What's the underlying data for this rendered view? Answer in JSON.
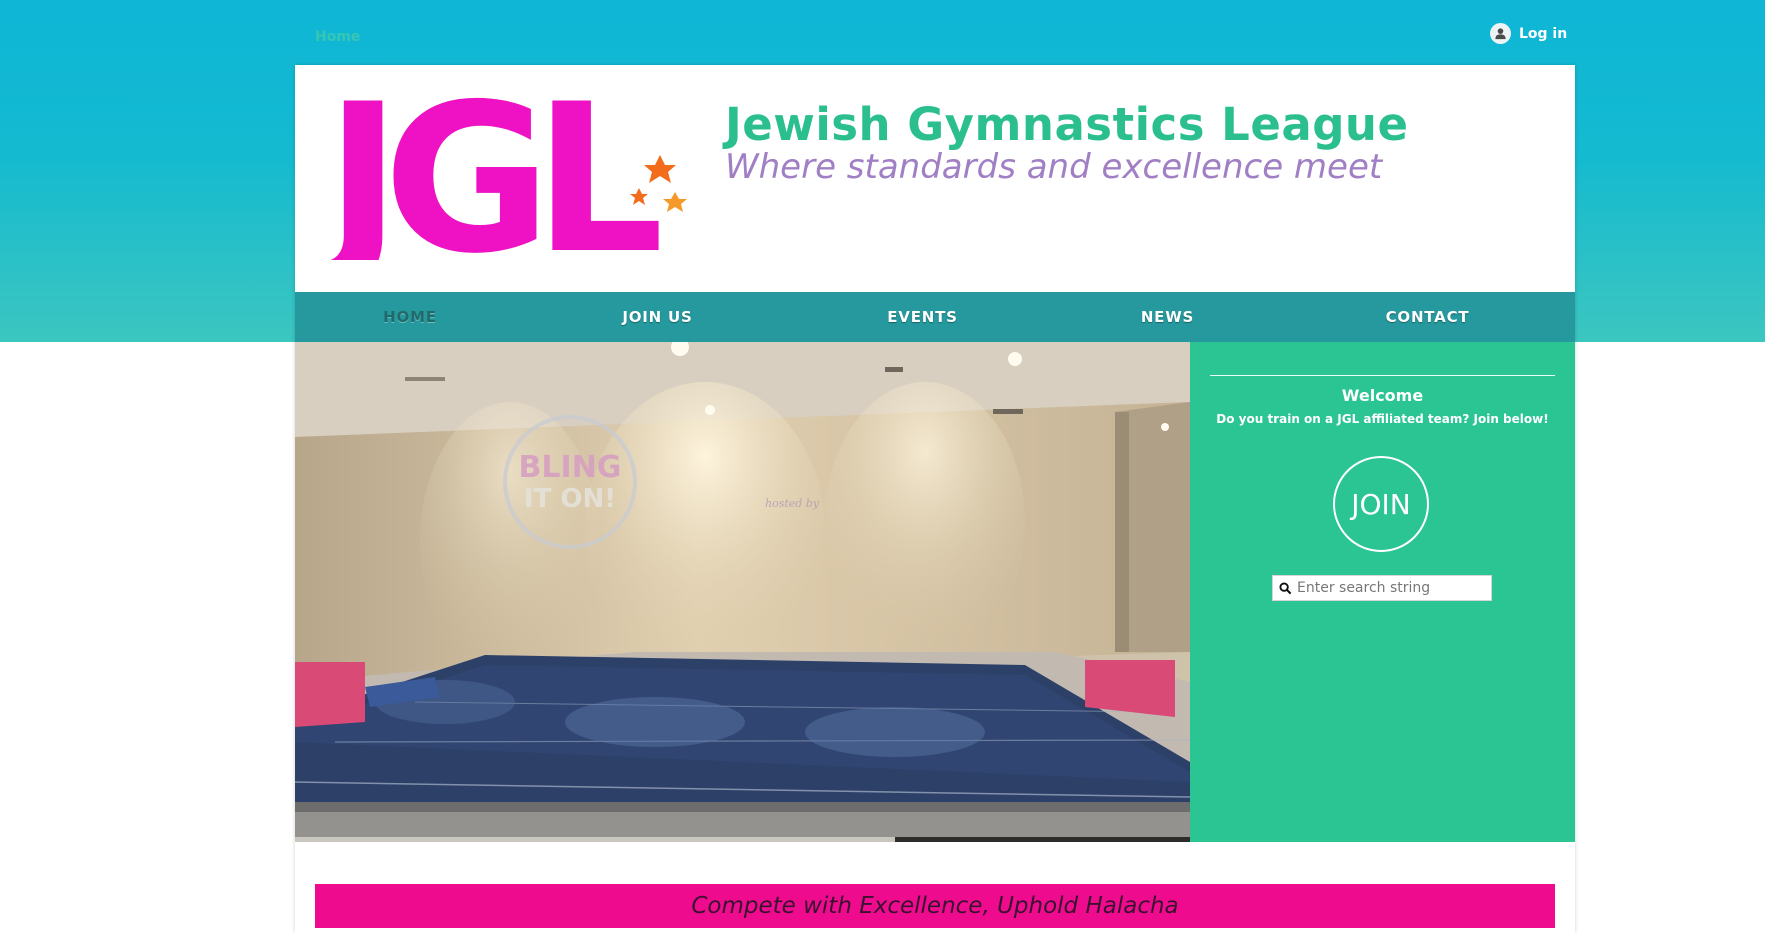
{
  "topbar": {
    "breadcrumb": "Home",
    "login_label": "Log in"
  },
  "header": {
    "logo_text": "JGL",
    "title": "Jewish Gymnastics League",
    "tagline": "Where standards and excellence meet"
  },
  "nav": {
    "items": [
      {
        "label": "HOME",
        "active": true
      },
      {
        "label": "JOIN US",
        "active": false
      },
      {
        "label": "EVENTS",
        "active": false
      },
      {
        "label": "NEWS",
        "active": false
      },
      {
        "label": "CONTACT",
        "active": false
      }
    ]
  },
  "hero": {
    "projection_title_1": "BLING",
    "projection_title_2": "IT ON!",
    "projection_credit": "hosted by",
    "slideshow_progress": 0.67
  },
  "sidebar": {
    "welcome": "Welcome",
    "subtitle": "Do you train  on a JGL affiliated team? Join below!",
    "join_label": "JOIN",
    "search_placeholder": "Enter search string"
  },
  "motto": "Compete with Excellence, Uphold Halacha",
  "colors": {
    "brand_teal": "#2bc493",
    "brand_magenta": "#ee0b8e",
    "title_green": "#2bbf8f",
    "tagline_purple": "#a07fc4",
    "nav_bg": "#25999d",
    "logo_magenta": "#ee12c4",
    "star_orange": "#f26c1b"
  },
  "icons": {
    "login": "user-avatar-icon",
    "search": "search-icon"
  }
}
